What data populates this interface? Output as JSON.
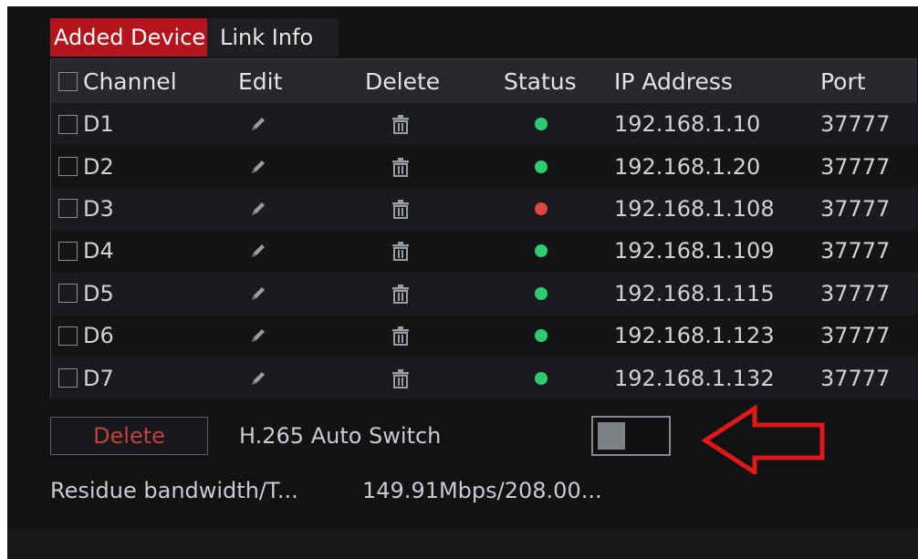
{
  "tabs": [
    {
      "label": "Added Device",
      "active": true
    },
    {
      "label": "Link Info",
      "active": false
    }
  ],
  "table": {
    "headers": {
      "channel": "Channel",
      "edit": "Edit",
      "delete": "Delete",
      "status": "Status",
      "ip": "IP Address",
      "port": "Port"
    },
    "rows": [
      {
        "channel": "D1",
        "status": "online",
        "ip": "192.168.1.10",
        "port": "37777"
      },
      {
        "channel": "D2",
        "status": "online",
        "ip": "192.168.1.20",
        "port": "37777"
      },
      {
        "channel": "D3",
        "status": "offline",
        "ip": "192.168.1.108",
        "port": "37777"
      },
      {
        "channel": "D4",
        "status": "online",
        "ip": "192.168.1.109",
        "port": "37777"
      },
      {
        "channel": "D5",
        "status": "online",
        "ip": "192.168.1.115",
        "port": "37777"
      },
      {
        "channel": "D6",
        "status": "online",
        "ip": "192.168.1.123",
        "port": "37777"
      },
      {
        "channel": "D7",
        "status": "online",
        "ip": "192.168.1.132",
        "port": "37777"
      }
    ]
  },
  "controls": {
    "delete_button": "Delete",
    "h265_label": "H.265 Auto Switch",
    "h265_enabled": false
  },
  "bandwidth": {
    "label": "Residue bandwidth/T...",
    "value": "149.91Mbps/208.00..."
  },
  "colors": {
    "accent": "#b4141c",
    "status_online": "#2ecc71",
    "status_offline": "#e0463f",
    "annotation_arrow": "#e01818"
  },
  "icons": {
    "edit": "pencil-icon",
    "delete": "trash-icon",
    "annotation": "left-arrow-icon"
  }
}
